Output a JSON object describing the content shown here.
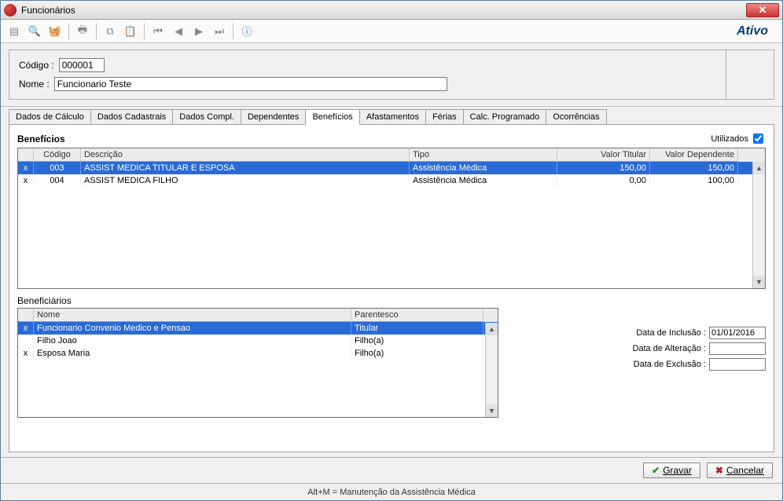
{
  "window": {
    "title": "Funcionários"
  },
  "status": "Ativo",
  "form": {
    "codigo_label": "Código :",
    "codigo": "000001",
    "nome_label": "Nome :",
    "nome": "Funcionario Teste"
  },
  "tabs": {
    "t0": "Dados de Cálculo",
    "t1": "Dados Cadastrais",
    "t2": "Dados Compl.",
    "t3": "Dependentes",
    "t4": "Benefícios",
    "t5": "Afastamentos",
    "t6": "Férias",
    "t7": "Calc. Programado",
    "t8": "Ocorrências"
  },
  "beneficios": {
    "title": "Benefícios",
    "utilizados_label": "Utilizados",
    "utilizados_checked": true,
    "cols": {
      "codigo": "Código",
      "descricao": "Descrição",
      "tipo": "Tipo",
      "valor_titular": "Valor Titular",
      "valor_dependente": "Valor Dependente"
    },
    "rows": [
      {
        "mark": "x",
        "codigo": "003",
        "descricao": "ASSIST MEDICA TITULAR E ESPOSA",
        "tipo": "Assistência Médica",
        "vt": "150,00",
        "vd": "150,00"
      },
      {
        "mark": "x",
        "codigo": "004",
        "descricao": "ASSIST MEDICA FILHO",
        "tipo": "Assistência Médica",
        "vt": "0,00",
        "vd": "100,00"
      }
    ]
  },
  "beneficiarios": {
    "title": "Beneficiários",
    "cols": {
      "nome": "Nome",
      "parentesco": "Parentesco"
    },
    "rows": [
      {
        "mark": "x",
        "nome": "Funcionario Convenio Medico e Pensao",
        "parentesco": "Titular"
      },
      {
        "mark": "",
        "nome": "Filho Joao",
        "parentesco": "Filho(a)"
      },
      {
        "mark": "x",
        "nome": "Esposa Maria",
        "parentesco": "Filho(a)"
      }
    ]
  },
  "dates": {
    "inclusao_label": "Data de Inclusão :",
    "inclusao": "01/01/2016",
    "alteracao_label": "Data de Alteração :",
    "alteracao": "",
    "exclusao_label": "Data de Exclusão :",
    "exclusao": ""
  },
  "buttons": {
    "gravar": "Gravar",
    "cancelar": "Cancelar"
  },
  "statusbar": "Alt+M = Manutenção da Assistência Médica"
}
